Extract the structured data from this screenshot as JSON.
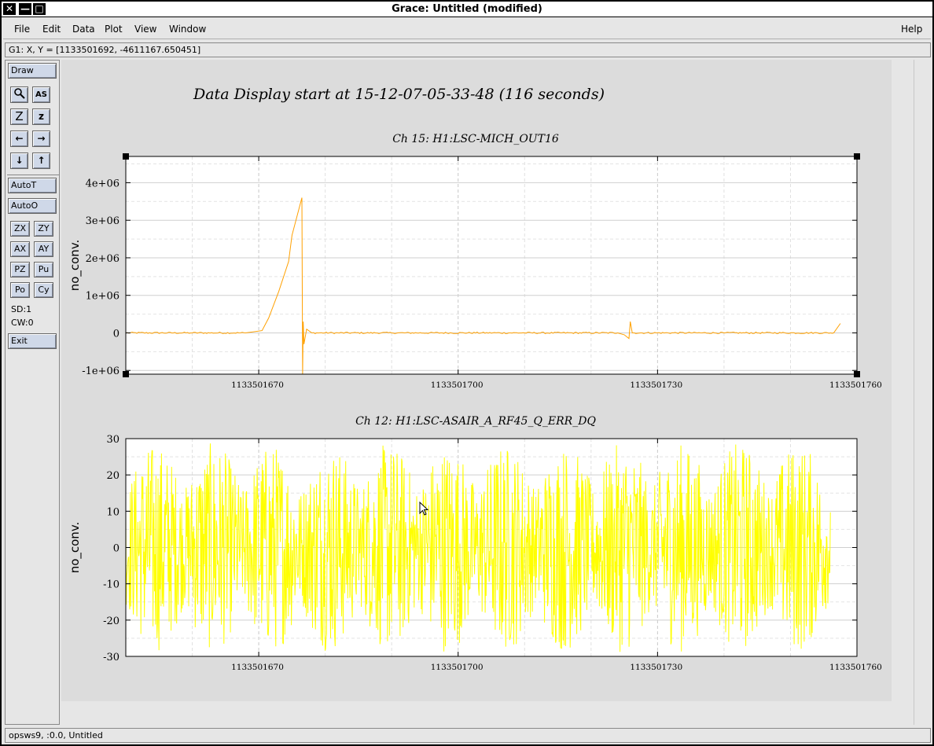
{
  "window": {
    "title": "Grace: Untitled (modified)",
    "controls": {
      "close": "✕",
      "minimize": "—",
      "maximize": "□"
    }
  },
  "menu": {
    "file": "File",
    "edit": "Edit",
    "data": "Data",
    "plot": "Plot",
    "view": "View",
    "window": "Window",
    "help": "Help"
  },
  "locator": "G1: X, Y = [1133501692, -4611167.650451]",
  "toolbar": {
    "draw": "Draw",
    "autot": "AutoT",
    "autoo": "AutoO",
    "zx": "ZX",
    "zy": "ZY",
    "ax": "AX",
    "ay": "AY",
    "pz": "PZ",
    "pu": "Pu",
    "po": "Po",
    "cy": "Cy",
    "sd": "SD:1",
    "cw": "CW:0",
    "exit": "Exit",
    "icons": [
      "zoom-icon",
      "autoscale-text-icon",
      "zoom-in-z-icon",
      "zoom-out-z-icon",
      "left-arrow-icon",
      "right-arrow-icon",
      "down-arrow-icon",
      "up-arrow-icon"
    ],
    "icon_glyphs": {
      "zoom": "🔍",
      "as": "AS",
      "zbig": "Z",
      "zsmall": "z",
      "left": "←",
      "right": "→",
      "down": "↓",
      "up": "↑"
    }
  },
  "status": "opsws9, :0.0, Untitled",
  "page_title": "Data Display start at 15-12-07-05-33-48 (116 seconds)",
  "colors": {
    "series1": "#ffa000",
    "series2": "#ffff00",
    "grid": "#d0d0d0",
    "canvas": "#dcdcdc"
  },
  "chart_data": [
    {
      "type": "line",
      "title": "Ch 15: H1:LSC-MICH_OUT16",
      "ylabel": "no_conv.",
      "xlabel": "",
      "xlim": [
        1133501650,
        1133501760
      ],
      "ylim": [
        -1100000,
        4700000
      ],
      "xticks": [
        1133501670,
        1133501700,
        1133501730,
        1133501760
      ],
      "xtick_labels": [
        "1133501670",
        "1133501700",
        "1133501730",
        "1133501760"
      ],
      "yticks": [
        -1000000,
        0,
        1000000,
        2000000,
        3000000,
        4000000
      ],
      "ytick_labels": [
        "-1e+06",
        "0",
        "1e+06",
        "2e+06",
        "3e+06",
        "4e+06"
      ],
      "grid": true,
      "series": [
        {
          "color": "#ffa000",
          "x": [
            1133501650,
            1133501660,
            1133501668,
            1133501670.5,
            1133501671.5,
            1133501673,
            1133501674.5,
            1133501675,
            1133501676.5,
            1133501676.6,
            1133501676.7,
            1133501676.8,
            1133501677.2,
            1133501678,
            1133501690,
            1133501710,
            1133501724,
            1133501725,
            1133501725.7,
            1133501725.9,
            1133501726.2,
            1133501726.5,
            1133501740,
            1133501756.5,
            1133501757.5
          ],
          "y": [
            0,
            0,
            0,
            60000,
            400000,
            1100000,
            1900000,
            2600000,
            3600000,
            -1100000,
            300000,
            -300000,
            100000,
            0,
            0,
            0,
            0,
            -50000,
            -150000,
            300000,
            0,
            0,
            0,
            0,
            250000
          ]
        }
      ]
    },
    {
      "type": "line",
      "title": "Ch 12: H1:LSC-ASAIR_A_RF45_Q_ERR_DQ",
      "ylabel": "no_conv.",
      "xlabel": "",
      "xlim": [
        1133501650,
        1133501760
      ],
      "ylim": [
        -30,
        30
      ],
      "xticks": [
        1133501670,
        1133501700,
        1133501730,
        1133501760
      ],
      "xtick_labels": [
        "1133501670",
        "1133501700",
        "1133501730",
        "1133501760"
      ],
      "yticks": [
        -30,
        -20,
        -10,
        0,
        10,
        20,
        30
      ],
      "ytick_labels": [
        "-30",
        "-20",
        "-10",
        "0",
        "10",
        "20",
        "30"
      ],
      "grid": true,
      "series": [
        {
          "color": "#ffff00",
          "x_start": 1133501650,
          "x_end": 1133501756,
          "description_values": "dense noise between about -29 and 29 centered on 0",
          "y_min": -29,
          "y_max": 29
        }
      ]
    }
  ]
}
